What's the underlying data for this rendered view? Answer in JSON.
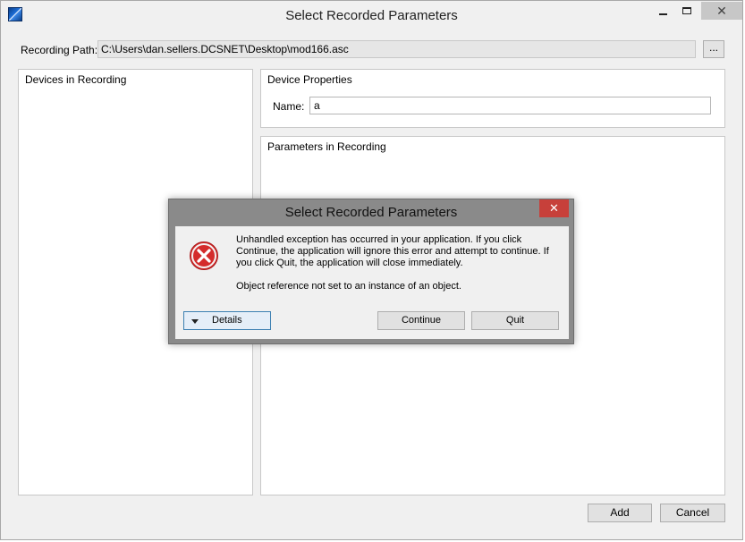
{
  "window": {
    "title": "Select Recorded Parameters",
    "close_glyph": "✕"
  },
  "recording": {
    "label": "Recording Path:",
    "path": "C:\\Users\\dan.sellers.DCSNET\\Desktop\\mod166.asc",
    "browse_label": "..."
  },
  "devices": {
    "title": "Devices in Recording"
  },
  "properties": {
    "title": "Device Properties",
    "name_label": "Name:",
    "name_value": "a"
  },
  "parameters": {
    "title": "Parameters in Recording"
  },
  "footer": {
    "add_label": "Add",
    "cancel_label": "Cancel"
  },
  "dialog": {
    "title": "Select Recorded Parameters",
    "close_glyph": "✕",
    "icon": "error-icon",
    "message": "Unhandled exception has occurred in your application. If you click Continue, the application will ignore this error and attempt to continue. If you click Quit, the application will close immediately.",
    "detail_message": "Object reference not set to an instance of an object.",
    "details_label": "Details",
    "continue_label": "Continue",
    "quit_label": "Quit"
  },
  "colors": {
    "close_red": "#c7403a",
    "error_red": "#d42b2b",
    "details_border": "#3c7fb1"
  }
}
